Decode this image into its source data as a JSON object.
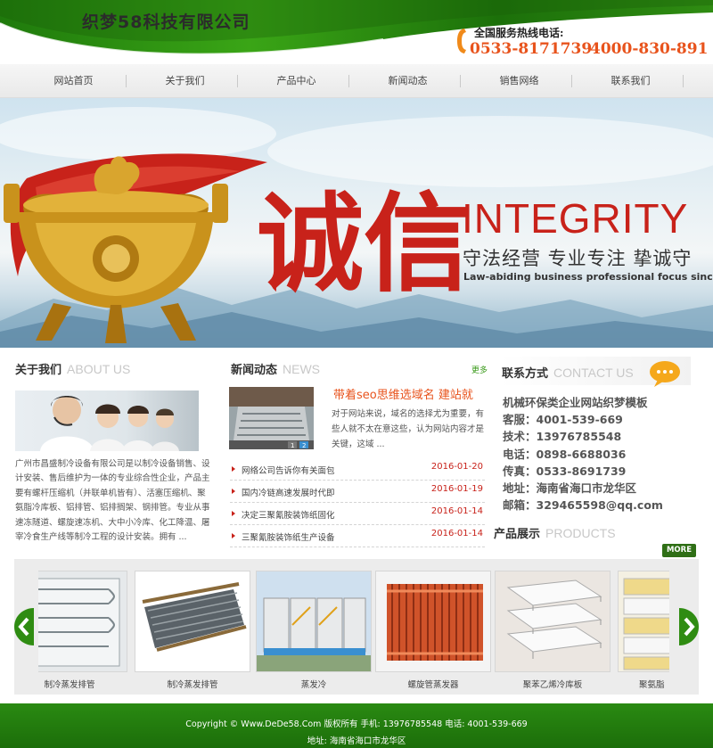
{
  "header": {
    "site_title": "织梦58科技有限公司",
    "hotline_label": "全国服务热线电话:",
    "hotline_phone_1": "0533-8171739",
    "hotline_phone_2": "4000-830-891"
  },
  "nav": {
    "items": [
      {
        "label": "网站首页"
      },
      {
        "label": "关于我们"
      },
      {
        "label": "产品中心"
      },
      {
        "label": "新闻动态"
      },
      {
        "label": "销售网络"
      },
      {
        "label": "联系我们"
      }
    ]
  },
  "banner": {
    "calligraphy": "诚信",
    "headline_en": "INTEGRITY",
    "headline_zh": "守法经营 专业专注 挚诚守",
    "subline_en": "Law-abiding business professional focus sincere pro"
  },
  "about": {
    "title_zh": "关于我们",
    "title_en": "ABOUT US",
    "text": "广州市昌盛制冷设备有限公司是以制冷设备销售、设计安装、售后维护为一体的专业综合性企业，产品主要有螺杆压缩机（并联单机皆有）、活塞压缩机、聚氨脂冷库板、铝排管、铝排搁架、钢排管。专业从事速冻隧道、螺旋速冻机、大中小冷库、化工降温、屠宰冷食生产线等制冷工程的设计安装。拥有 ..."
  },
  "news": {
    "title_zh": "新闻动态",
    "title_en": "NEWS",
    "more_label": "更多",
    "featured_title": "带着seo思维选域名 建站就",
    "featured_summary": "对于网站来说，域名的选择尤为重要，有些人就不太在意这些，认为网站内容才是关键，这域 ...",
    "slide_numbers": [
      "1",
      "2"
    ],
    "items": [
      {
        "title": "网络公司告诉你有关面包",
        "date": "2016-01-20"
      },
      {
        "title": "国内冷链高速发展时代即",
        "date": "2016-01-19"
      },
      {
        "title": "决定三聚氰胺装饰纸固化",
        "date": "2016-01-14"
      },
      {
        "title": "三聚氰胺装饰纸生产设备",
        "date": "2016-01-14"
      }
    ]
  },
  "contact": {
    "title_zh": "联系方式",
    "title_en": "CONTACT US",
    "lines": [
      "机械环保类企业网站织梦模板",
      "客服：4001-539-669",
      "技术：13976785548",
      "电话：0898-6688036",
      "传真：0533-8691739",
      "地址：海南省海口市龙华区",
      "邮箱：329465598@qq.com"
    ]
  },
  "products": {
    "title_zh": "产品展示",
    "title_en": "PRODUCTS",
    "more_label": "MORE",
    "items": [
      {
        "caption": "制冷蒸发排管"
      },
      {
        "caption": "制冷蒸发排管"
      },
      {
        "caption": "蒸发冷"
      },
      {
        "caption": "螺旋管蒸发器"
      },
      {
        "caption": "聚苯乙烯冷库板"
      },
      {
        "caption": "聚氨脂"
      }
    ]
  },
  "footer": {
    "line1": "Copyright © Www.DeDe58.Com 版权所有 手机: 13976785548 电话: 4001-539-669",
    "line2": "地址: 海南省海口市龙华区"
  },
  "colors": {
    "brand_green": "#2a8a12",
    "accent_orange": "#e8531c",
    "accent_red": "#c8221a"
  }
}
